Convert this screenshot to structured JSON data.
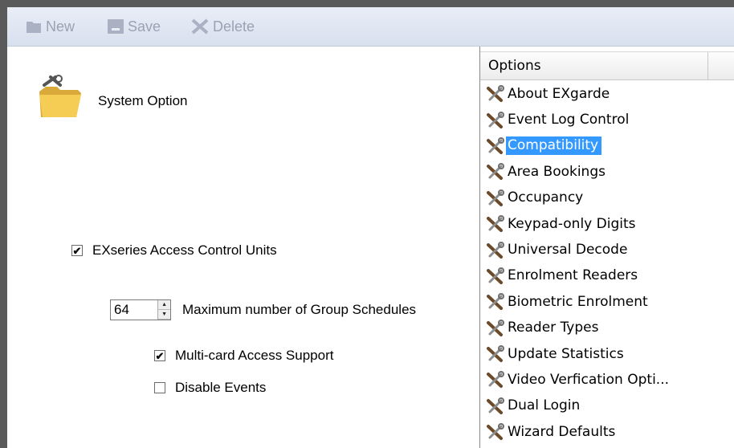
{
  "toolbar": {
    "new_label": "New",
    "save_label": "Save",
    "delete_label": "Delete"
  },
  "left": {
    "title": "System Option",
    "exseries": {
      "label": "EXseries Access Control Units",
      "checked": true
    },
    "group_schedules": {
      "value": "64",
      "label": "Maximum number of Group Schedules"
    },
    "multicard": {
      "label": "Multi-card Access Support",
      "checked": true
    },
    "disable_events": {
      "label": "Disable Events",
      "checked": false
    }
  },
  "options": {
    "header": "Options",
    "selected_index": 2,
    "items": [
      "About EXgarde",
      "Event Log Control",
      "Compatibility",
      "Area Bookings",
      "Occupancy",
      "Keypad-only Digits",
      "Universal Decode",
      "Enrolment Readers",
      "Biometric Enrolment",
      "Reader Types",
      "Update Statistics",
      "Video Verfication Opti...",
      "Dual Login",
      "Wizard Defaults"
    ]
  },
  "colors": {
    "selection": "#3399ff",
    "toolbar": "#dde4f0",
    "disabled_text": "#9aa3b3"
  },
  "icons": {
    "option_item": "tools-icon",
    "system": "folder-tools-icon"
  }
}
